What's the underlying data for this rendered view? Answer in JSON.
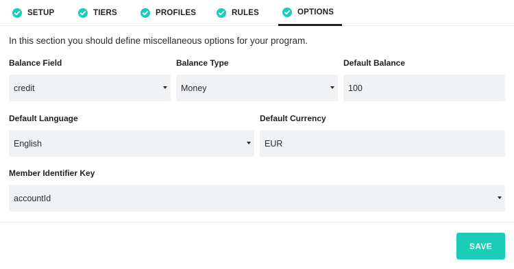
{
  "tabs": [
    {
      "label": "SETUP",
      "icon": "check-circle-icon"
    },
    {
      "label": "TIERS",
      "icon": "check-circle-icon"
    },
    {
      "label": "PROFILES",
      "icon": "check-circle-icon"
    },
    {
      "label": "RULES",
      "icon": "check-circle-icon"
    },
    {
      "label": "OPTIONS",
      "icon": "check-circle-icon",
      "active": true
    }
  ],
  "colors": {
    "accent": "#19cdb9",
    "field_bg": "#f1f2f4",
    "text": "#1d1f24"
  },
  "intro": "In this section you should define miscellaneous options for your program.",
  "fields": {
    "balance_field": {
      "label": "Balance Field",
      "value": "credit"
    },
    "balance_type": {
      "label": "Balance Type",
      "value": "Money"
    },
    "default_balance": {
      "label": "Default Balance",
      "value": "100"
    },
    "default_language": {
      "label": "Default Language",
      "value": "English"
    },
    "default_currency": {
      "label": "Default Currency",
      "value": "EUR"
    },
    "member_identifier_key": {
      "label": "Member Identifier Key",
      "value": "accountId"
    }
  },
  "actions": {
    "save_label": "SAVE"
  }
}
